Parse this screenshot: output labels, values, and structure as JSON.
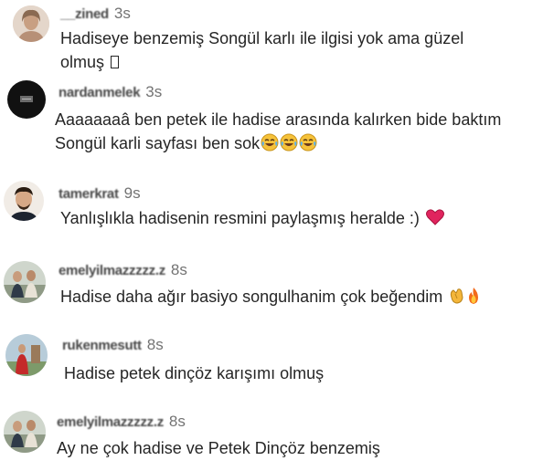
{
  "comments": [
    {
      "username": "__zined",
      "time": "3s",
      "lines": [
        "Hadiseye benzemiş Songül karlı ile ilgisi yok ama güzel",
        "olmuş"
      ],
      "emojis": [
        "missing-glyph"
      ]
    },
    {
      "username": "nardanmelek",
      "time": "3s",
      "lines": [
        "Aaaaaaaâ ben petek ile hadise arasında kalırken bide baktım",
        "Songül karli sayfası ben sok"
      ],
      "emojis": [
        "tears-of-joy",
        "tears-of-joy",
        "tears-of-joy"
      ]
    },
    {
      "username": "tamerkrat",
      "time": "9s",
      "lines": [
        "Yanlışlıkla hadisenin resmini paylaşmış heralde :)"
      ],
      "emojis": [
        "red-heart"
      ]
    },
    {
      "username": "emelyilmazzzzz.z",
      "time": "8s",
      "lines": [
        "Hadise daha ağır basiyo songulhanim çok beğendim"
      ],
      "emojis": [
        "clapping-hands",
        "fire"
      ]
    },
    {
      "username": "rukenmesutt",
      "time": "8s",
      "lines": [
        "Hadise petek dinçöz karışımı olmuş"
      ],
      "emojis": []
    },
    {
      "username": "emelyilmazzzzz.z",
      "time": "8s",
      "lines": [
        "Ay ne çok hadise ve Petek Dinçöz benzemiş"
      ],
      "emojis": []
    }
  ],
  "colors": {
    "text": "#262626",
    "secondary": "#737373",
    "heart": "#e0245e"
  }
}
